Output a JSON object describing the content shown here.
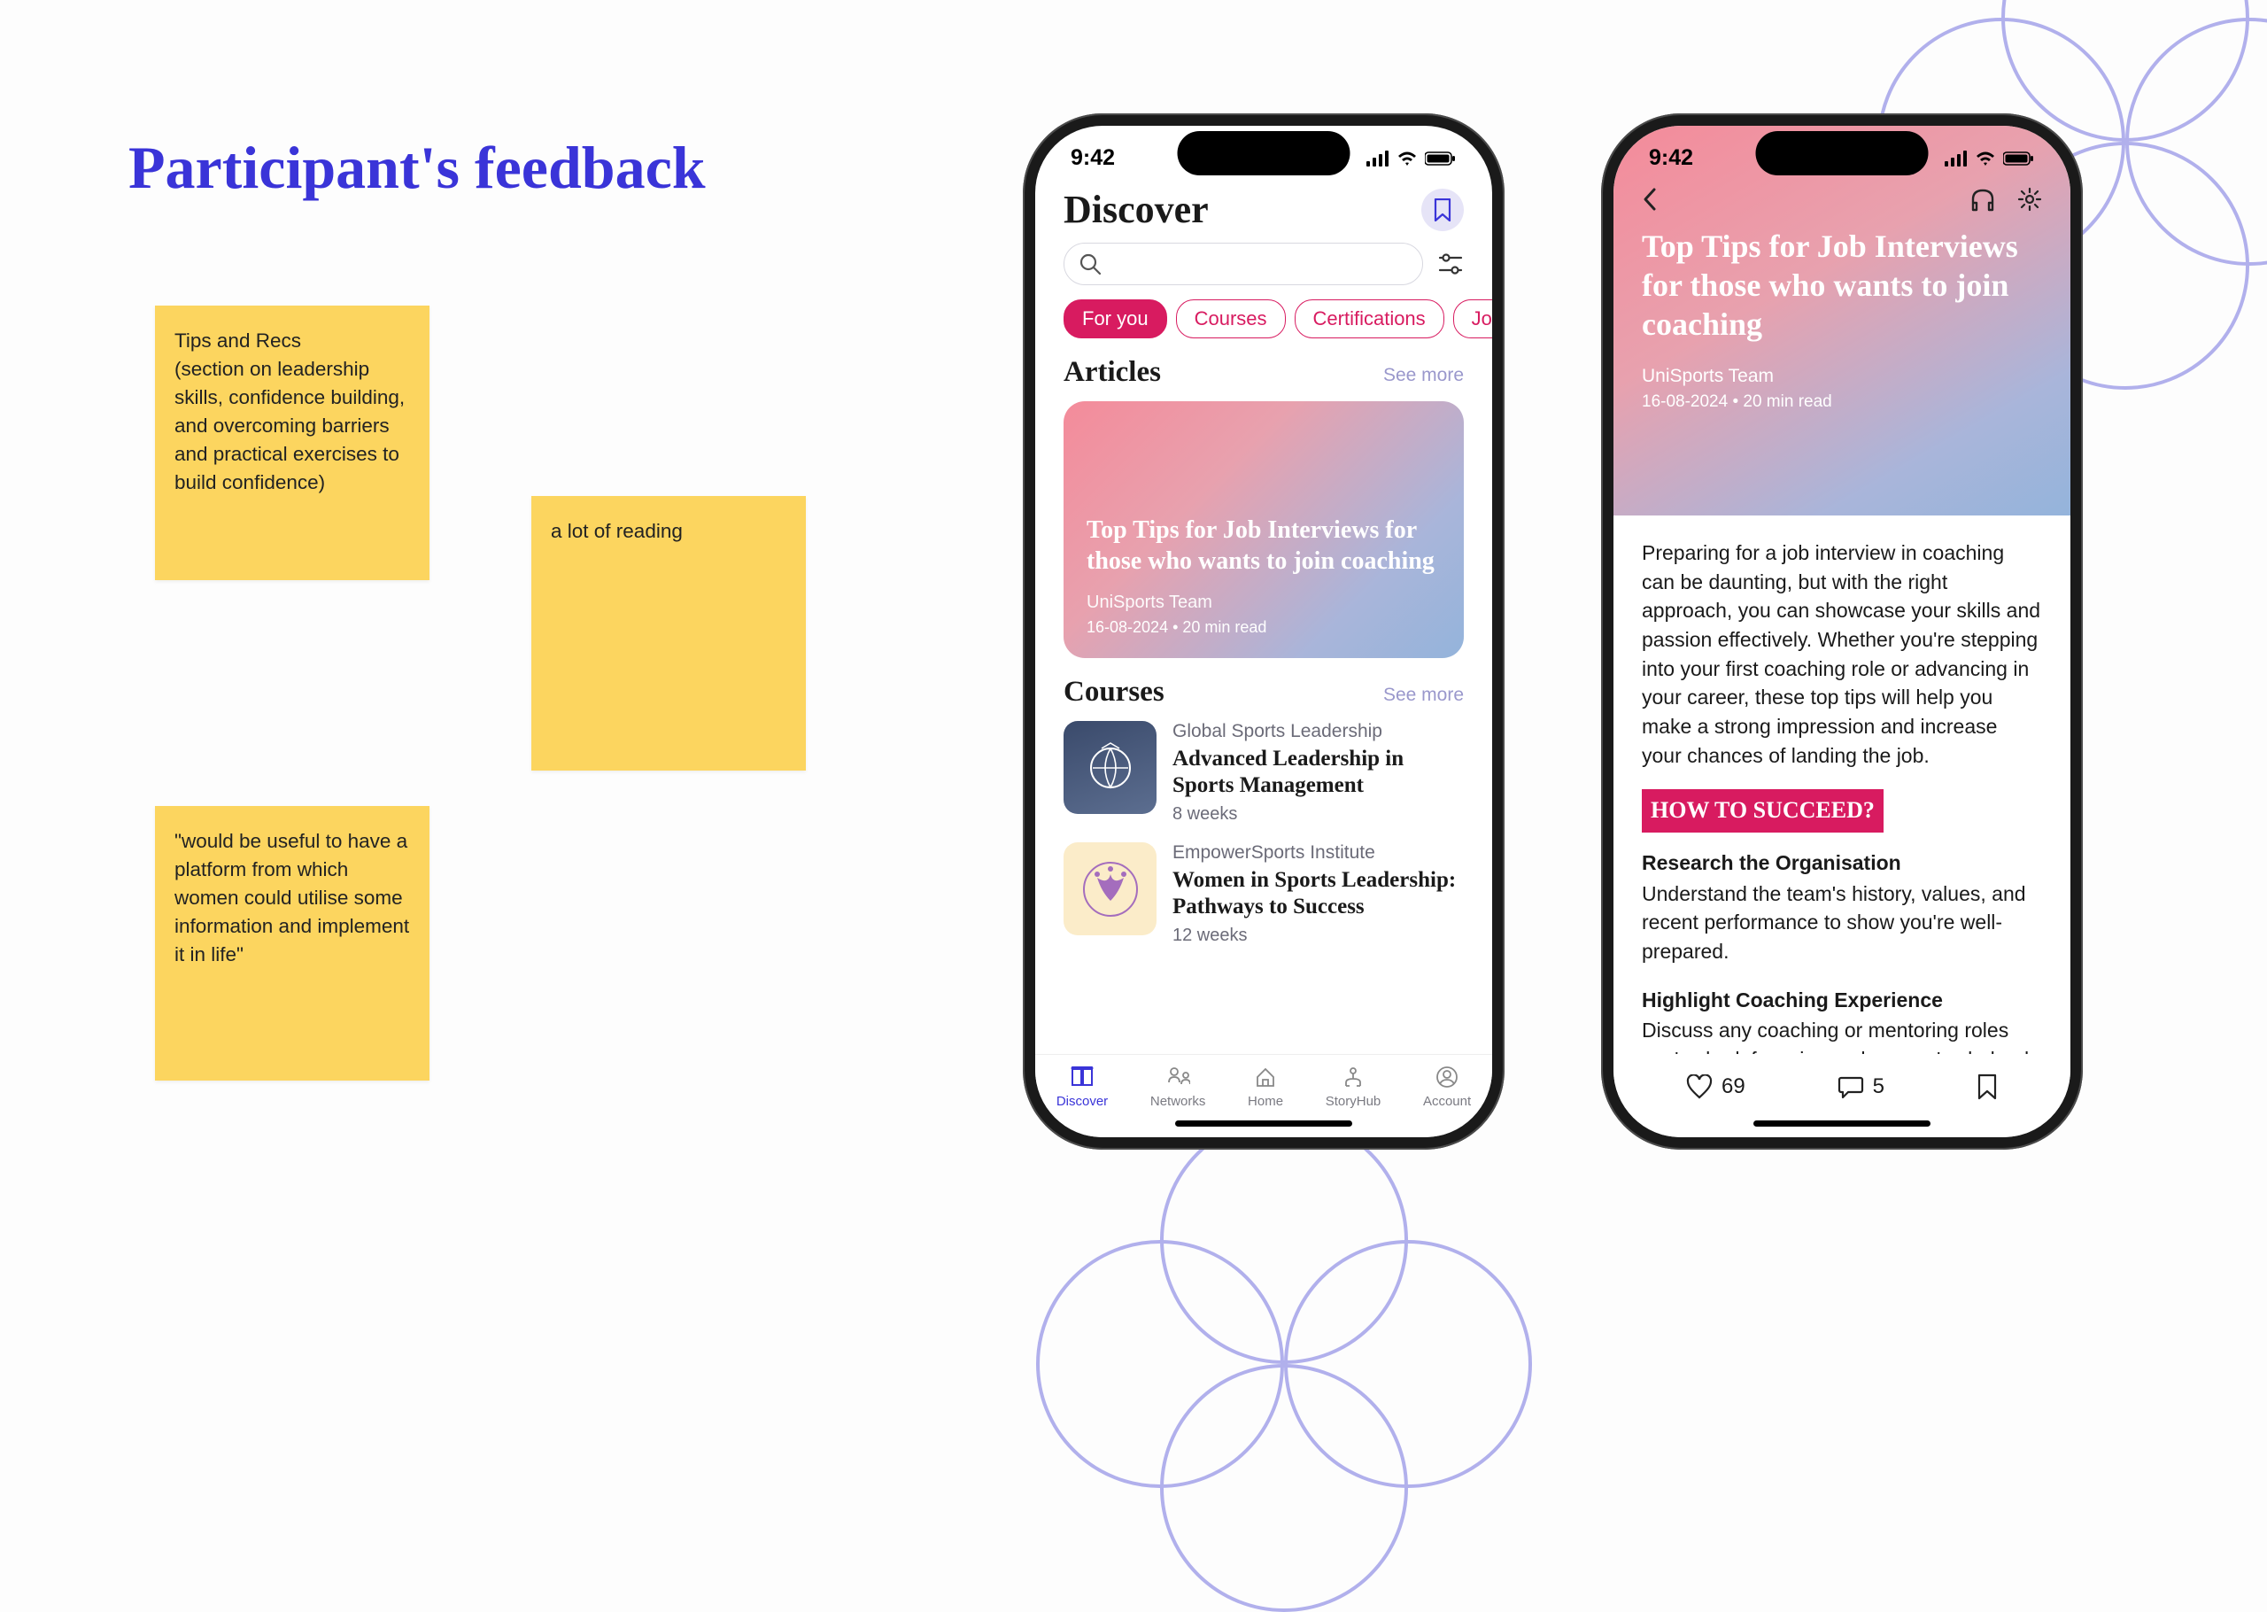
{
  "slide": {
    "title": "Participant's feedback"
  },
  "stickies": {
    "s1": "Tips and Recs\n(section on leadership skills, confidence building, and overcoming barriers and practical exercises to build confidence)",
    "s2": "a lot of reading",
    "s3": "\"would be useful to have a platform from which women could utilise some information and implement it in life\""
  },
  "status": {
    "time": "9:42"
  },
  "discover": {
    "title": "Discover",
    "search_placeholder": "",
    "chips": [
      "For you",
      "Courses",
      "Certifications",
      "Job Oppor"
    ],
    "articles_header": "Articles",
    "see_more": "See more",
    "article": {
      "title": "Top Tips for Job Interviews for those who wants to join coaching",
      "author": "UniSports Team",
      "meta": "16-08-2024  •  20 min read"
    },
    "courses_header": "Courses",
    "courses": [
      {
        "provider": "Global Sports Leadership",
        "title": "Advanced Leadership in Sports Management",
        "duration": "8 weeks"
      },
      {
        "provider": "EmpowerSports Institute",
        "title": "Women in Sports Leadership: Pathways to Success",
        "duration": "12 weeks"
      }
    ],
    "tabs": [
      "Discover",
      "Networks",
      "Home",
      "StoryHub",
      "Account"
    ]
  },
  "detail": {
    "title": "Top Tips for Job Interviews for those who wants to join coaching",
    "author": "UniSports Team",
    "meta": "16-08-2024  •  20 min read",
    "intro": "Preparing for a job interview in coaching can be daunting, but with the right approach, you can showcase your skills and passion effectively. Whether you're stepping into your first coaching role or advancing in your career, these top tips will help you make a strong impression and increase your chances of landing the job.",
    "succeed_label": "HOW TO SUCCEED?",
    "tip1h": "Research the Organisation",
    "tip1": "Understand the team's history, values, and recent performance to show you're well-prepared.",
    "tip2h": "Highlight Coaching Experience",
    "tip2": "Discuss any coaching or mentoring roles you've had, focusing on how you've helped players improve.",
    "likes": "69",
    "comments": "5"
  }
}
